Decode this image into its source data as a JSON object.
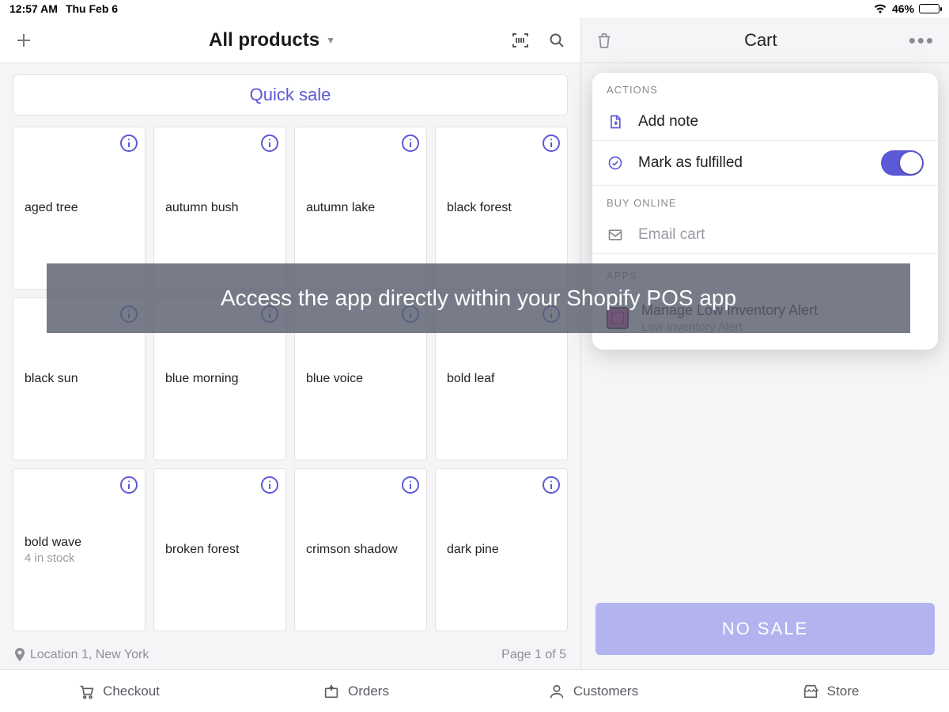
{
  "status": {
    "time": "12:57 AM",
    "date": "Thu Feb 6",
    "battery": "46%"
  },
  "left": {
    "title": "All products",
    "quick_sale": "Quick sale",
    "products": [
      {
        "name": "aged tree"
      },
      {
        "name": "autumn bush"
      },
      {
        "name": "autumn lake"
      },
      {
        "name": "black forest"
      },
      {
        "name": "black sun"
      },
      {
        "name": "blue morning"
      },
      {
        "name": "blue voice"
      },
      {
        "name": "bold leaf"
      },
      {
        "name": "bold wave",
        "stock": "4 in stock"
      },
      {
        "name": "broken forest"
      },
      {
        "name": "crimson shadow"
      },
      {
        "name": "dark pine"
      }
    ],
    "location": "Location 1, New York",
    "page": "Page 1 of 5"
  },
  "right": {
    "title": "Cart",
    "actions_label": "ACTIONS",
    "add_note": "Add note",
    "mark_fulfilled": "Mark as fulfilled",
    "buy_online_label": "BUY ONLINE",
    "email_cart": "Email cart",
    "apps_label": "APPS",
    "app_title": "Manage Low Inventory Alert",
    "app_subtitle": "Low Inventory Alert",
    "no_sale": "NO SALE"
  },
  "banner": "Access the app directly within your Shopify POS app",
  "nav": {
    "checkout": "Checkout",
    "orders": "Orders",
    "customers": "Customers",
    "store": "Store"
  }
}
